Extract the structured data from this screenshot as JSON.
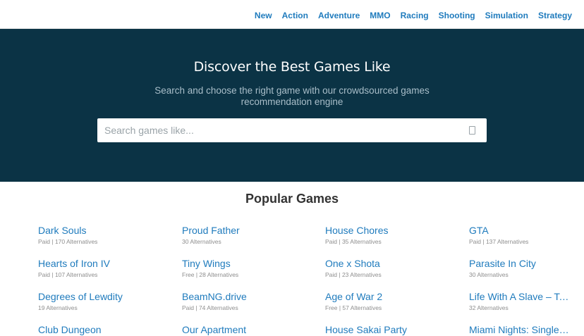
{
  "nav": {
    "items": [
      "New",
      "Action",
      "Adventure",
      "MMO",
      "Racing",
      "Shooting",
      "Simulation",
      "Strategy"
    ]
  },
  "hero": {
    "title": "Discover the Best Games Like",
    "subtitle": "Search and choose the right game with our crowdsourced games recommendation engine",
    "search_placeholder": "Search games like..."
  },
  "popular": {
    "title": "Popular Games",
    "columns": [
      [
        {
          "name": "Dark Souls",
          "meta": "Paid | 170 Alternatives"
        },
        {
          "name": "Hearts of Iron IV",
          "meta": "Paid | 107 Alternatives"
        },
        {
          "name": "Degrees of Lewdity",
          "meta": "19 Alternatives"
        },
        {
          "name": "Club Dungeon",
          "meta": ""
        }
      ],
      [
        {
          "name": "Proud Father",
          "meta": "30 Alternatives"
        },
        {
          "name": "Tiny Wings",
          "meta": "Free | 28 Alternatives"
        },
        {
          "name": "BeamNG.drive",
          "meta": "Paid | 74 Alternatives"
        },
        {
          "name": "Our Apartment",
          "meta": ""
        }
      ],
      [
        {
          "name": "House Chores",
          "meta": "Paid | 35 Alternatives"
        },
        {
          "name": "One x Shota",
          "meta": "Paid | 23 Alternatives"
        },
        {
          "name": "Age of War 2",
          "meta": "Free | 57 Alternatives"
        },
        {
          "name": "House Sakai Party",
          "meta": ""
        }
      ],
      [
        {
          "name": "GTA",
          "meta": "Paid | 137 Alternatives"
        },
        {
          "name": "Parasite In City",
          "meta": "30 Alternatives"
        },
        {
          "name": "Life With A Slave – Teaching Feeling",
          "meta": "32 Alternatives"
        },
        {
          "name": "Miami Nights: Singles in the City",
          "meta": ""
        }
      ]
    ]
  },
  "colors": {
    "hero_bg": "#0b3345",
    "link": "#1f7bbd"
  }
}
